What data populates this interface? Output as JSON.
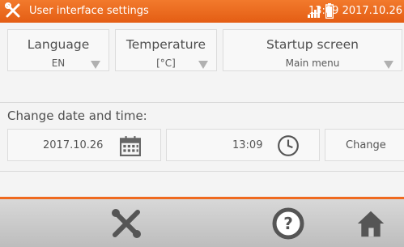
{
  "status_bar": {
    "title": "User interface settings",
    "time_date": "13:09 2017.10.26",
    "accent": "#e86a1f",
    "icons": [
      "tools-icon",
      "signal-icon",
      "battery-icon"
    ]
  },
  "settings": {
    "language": {
      "label": "Language",
      "value": "EN"
    },
    "temperature": {
      "label": "Temperature",
      "value": "[°C]"
    },
    "startup": {
      "label": "Startup screen",
      "value": "Main menu"
    }
  },
  "datetime": {
    "section_title": "Change date and time:",
    "date": "2017.10.26",
    "time": "13:09",
    "change_label": "Change"
  },
  "bottom_bar": {
    "icons": [
      "tools-icon",
      "help-icon",
      "home-icon"
    ]
  }
}
